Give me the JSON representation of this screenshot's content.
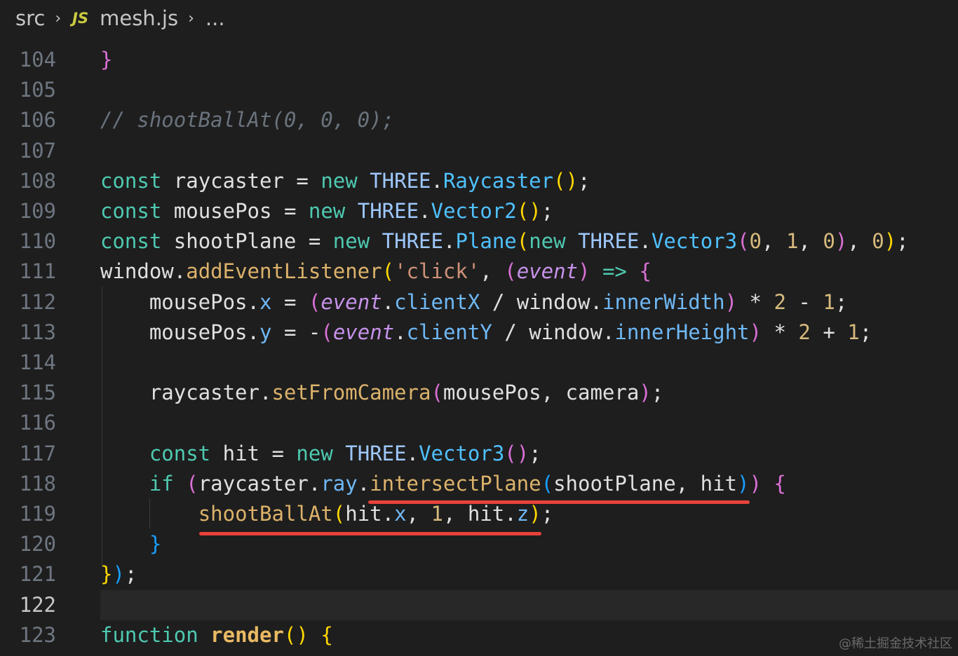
{
  "breadcrumb": {
    "folder": "src",
    "file_icon": "JS",
    "file": "mesh.js",
    "more": "..."
  },
  "editor": {
    "active_line": "122",
    "lines": [
      {
        "num": "104",
        "text": "}"
      },
      {
        "num": "105",
        "text": ""
      },
      {
        "num": "106",
        "text": "// shootBallAt(0, 0, 0);"
      },
      {
        "num": "107",
        "text": ""
      },
      {
        "num": "108",
        "text": "const raycaster = new THREE.Raycaster();"
      },
      {
        "num": "109",
        "text": "const mousePos = new THREE.Vector2();"
      },
      {
        "num": "110",
        "text": "const shootPlane = new THREE.Plane(new THREE.Vector3(0, 1, 0), 0);"
      },
      {
        "num": "111",
        "text": "window.addEventListener('click', (event) => {"
      },
      {
        "num": "112",
        "text": "    mousePos.x = (event.clientX / window.innerWidth) * 2 - 1;"
      },
      {
        "num": "113",
        "text": "    mousePos.y = -(event.clientY / window.innerHeight) * 2 + 1;"
      },
      {
        "num": "114",
        "text": ""
      },
      {
        "num": "115",
        "text": "    raycaster.setFromCamera(mousePos, camera);"
      },
      {
        "num": "116",
        "text": ""
      },
      {
        "num": "117",
        "text": "    const hit = new THREE.Vector3();"
      },
      {
        "num": "118",
        "text": "    if (raycaster.ray.intersectPlane(shootPlane, hit)) {"
      },
      {
        "num": "119",
        "text": "        shootBallAt(hit.x, 1, hit.z);"
      },
      {
        "num": "120",
        "text": "    }"
      },
      {
        "num": "121",
        "text": "});"
      },
      {
        "num": "122",
        "text": ""
      },
      {
        "num": "123",
        "text": "function render() {"
      }
    ]
  },
  "watermark": "@稀土掘金技术社区"
}
